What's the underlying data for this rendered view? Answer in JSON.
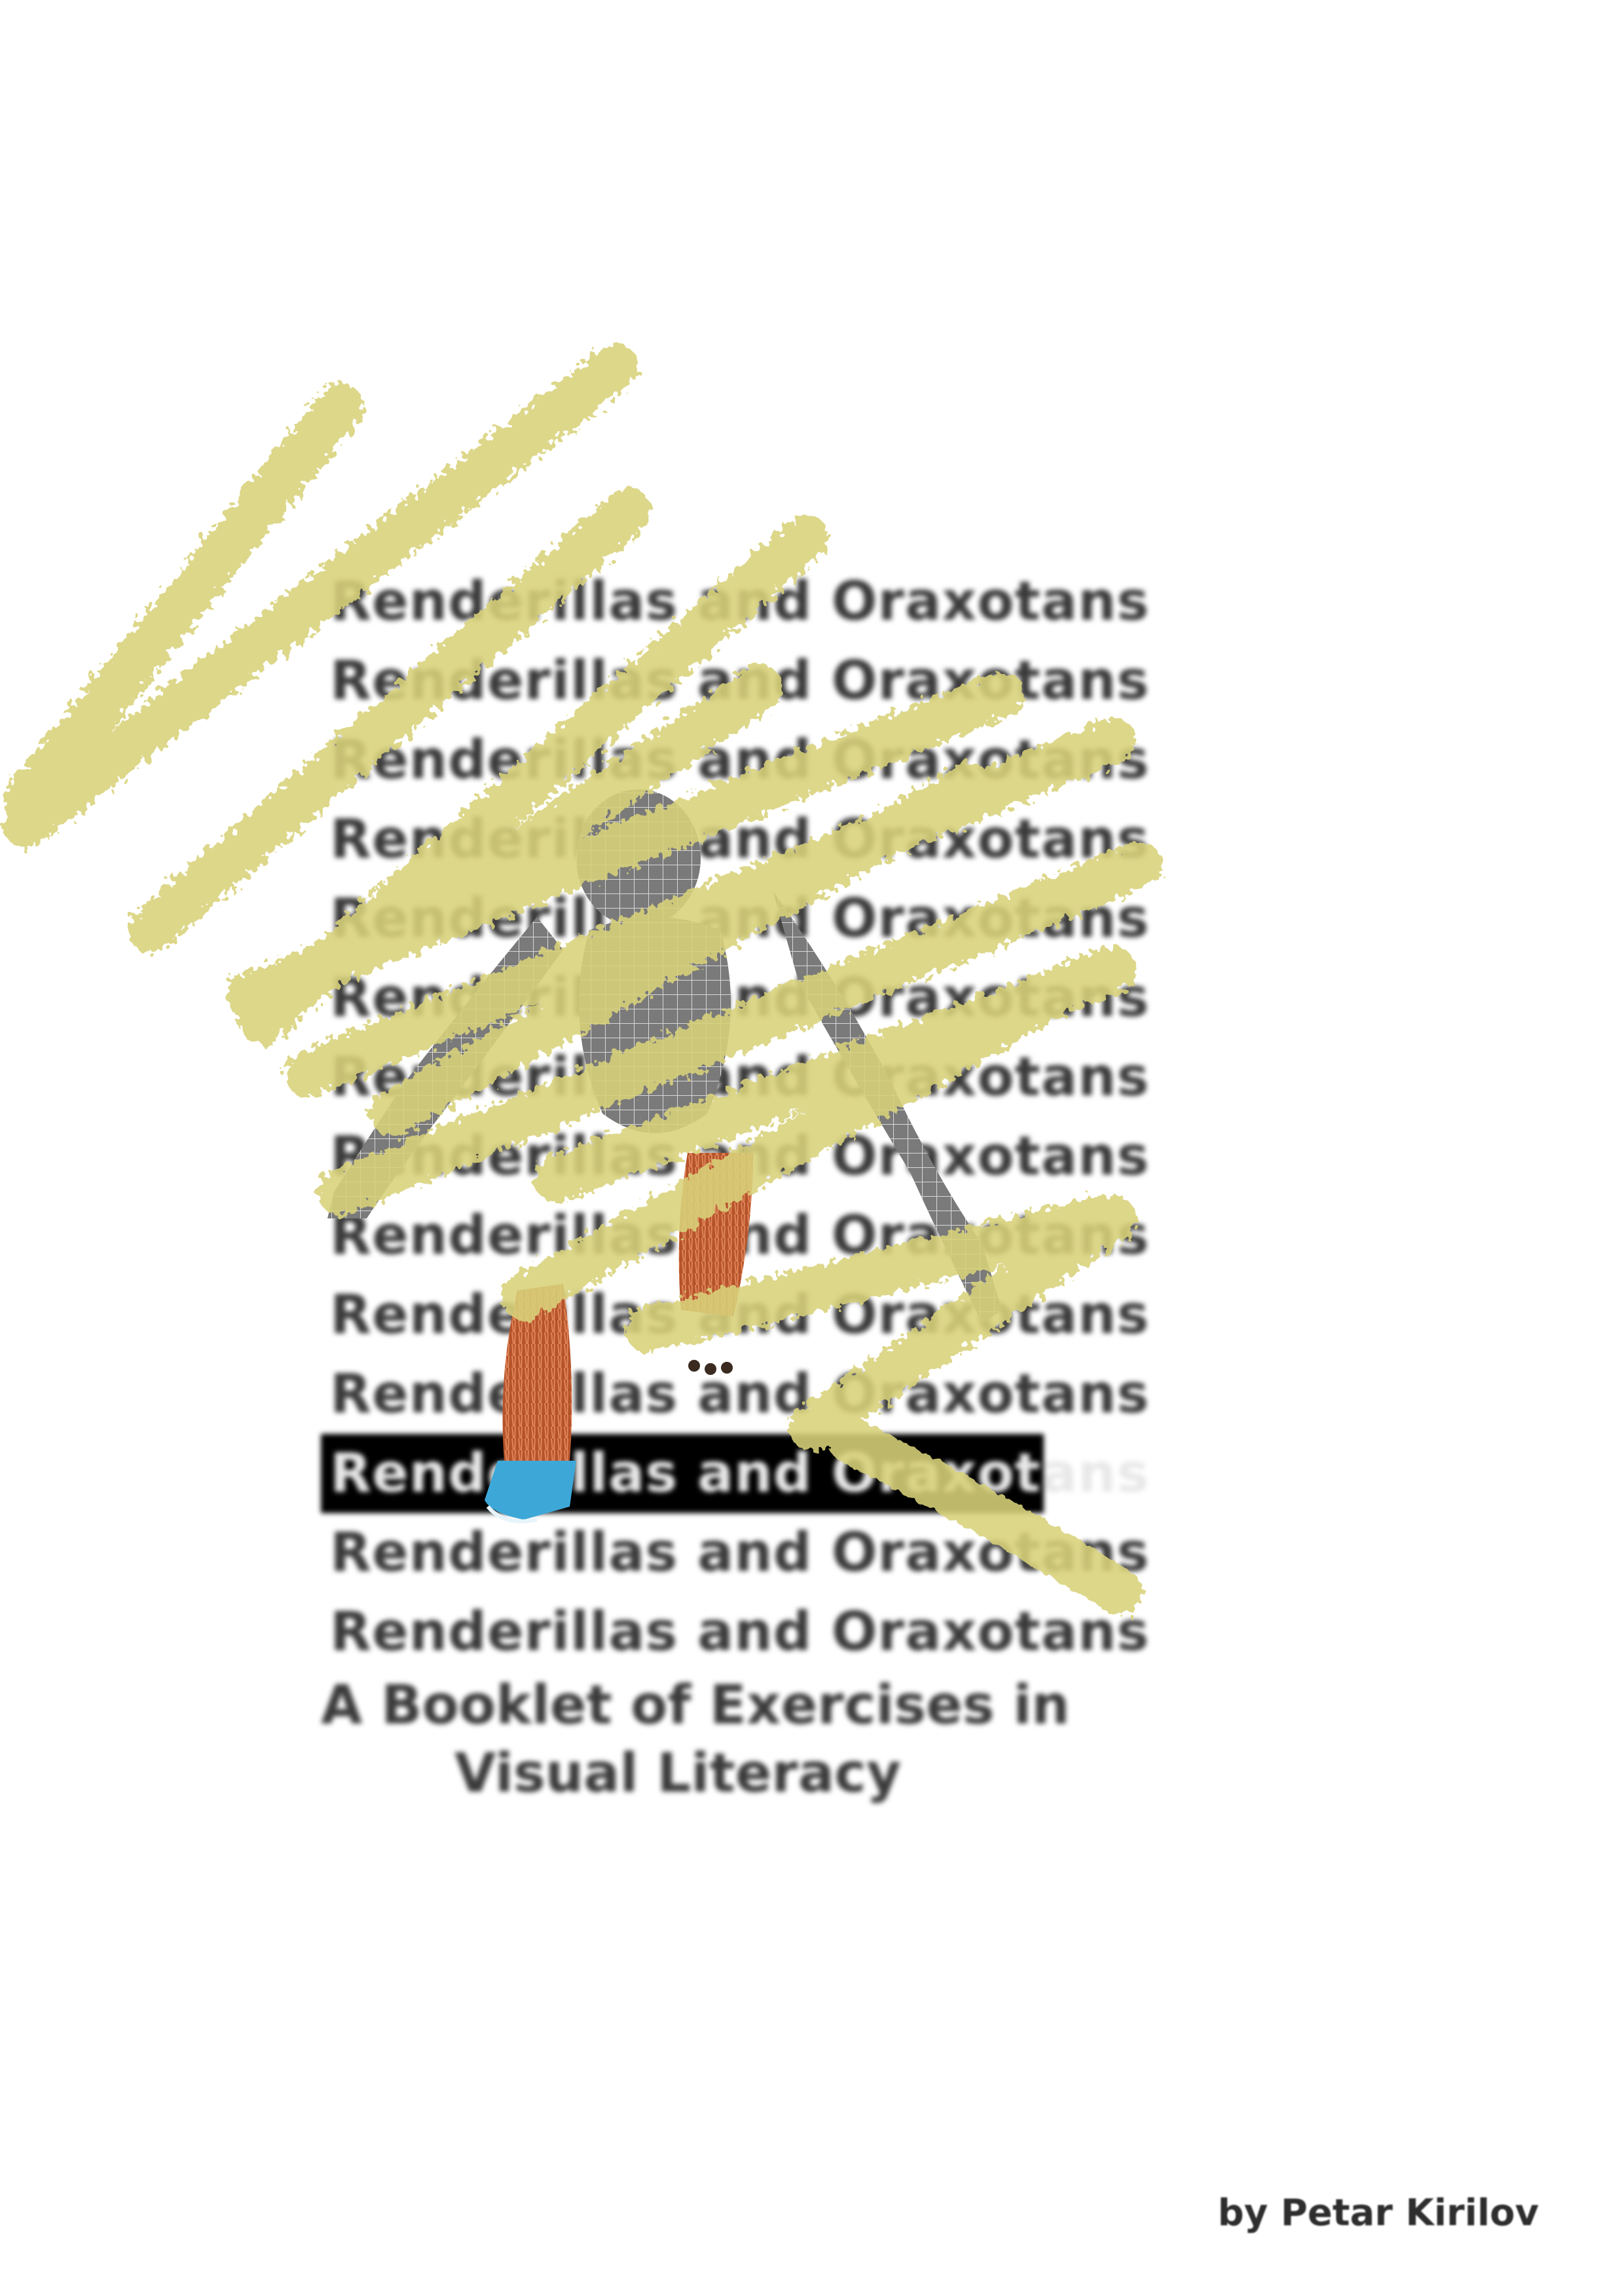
{
  "cover": {
    "title_lines": [
      "Renderillas and Oraxotans",
      "Renderillas and Oraxotans",
      "Renderillas and Oraxotans",
      "Renderillas and Oraxotans",
      "Renderillas and Oraxotans",
      "Renderillas and Oraxotans",
      "Renderillas and Oraxotans",
      "Renderillas and Oraxotans",
      "Renderillas and Oraxotans",
      "Renderillas and Oraxotans",
      "Renderillas and Oraxotans",
      "Renderillas and Oraxotans",
      "Renderillas and Oraxotans",
      "Renderillas and Oraxotans"
    ],
    "highlighted_line_index": 11,
    "subtitle_line_1": "A Booklet of Exercises in",
    "subtitle_line_2": "Visual Literacy",
    "author": "by Petar Kirilov"
  },
  "colors": {
    "background": "#ffffff",
    "text": "#3a3a3a",
    "highlight_band": "#000000",
    "scribble": "#d9d27a",
    "mesh": "#6e6e6e",
    "fur": "#b5532a",
    "blue_fur": "#3da8d8"
  },
  "artwork": {
    "figure": "wireframe-primate-figure",
    "overlay": "yellow-crayon-scribbles"
  }
}
